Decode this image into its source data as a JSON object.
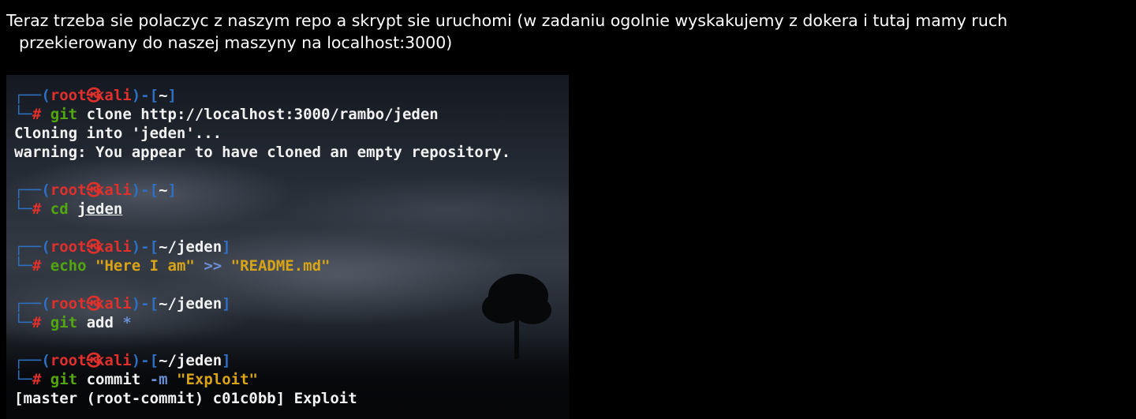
{
  "intro": {
    "line1": "Teraz trzeba sie polaczyc z naszym repo a skrypt sie uruchomi (w zadaniu ogolnie wyskakujemy z dokera i tutaj mamy ruch",
    "line2": "przekierowany do naszej maszyny na localhost:3000)"
  },
  "terminal": {
    "prompt_user": "root",
    "prompt_host": "kali",
    "skull_glyph": "㉿",
    "sessions": [
      {
        "dir": "~",
        "command": "git",
        "args": "clone http://localhost:3000/rambo/jeden",
        "output": [
          "Cloning into 'jeden'...",
          "warning: You appear to have cloned an empty repository."
        ]
      },
      {
        "dir": "~",
        "command": "cd",
        "args": "jeden"
      },
      {
        "dir": "~/jeden",
        "command": "echo",
        "string1": "\"Here I am\"",
        "operator": ">>",
        "string2": "\"README.md\""
      },
      {
        "dir": "~/jeden",
        "command": "git",
        "args": "add",
        "glob": "*"
      },
      {
        "dir": "~/jeden",
        "command": "git",
        "args": "commit",
        "flag": "-m",
        "string1": "\"Exploit\"",
        "output": [
          "[master (root-commit) c01c0bb] Exploit"
        ]
      }
    ]
  },
  "colors": {
    "prompt_frame": "#2f6fc2",
    "prompt_user_host": "#e0302c",
    "command": "#52a60f",
    "string": "#d9a316",
    "operator": "#6a8fd6",
    "text": "#f2f2f2",
    "page_background": "#000000"
  }
}
